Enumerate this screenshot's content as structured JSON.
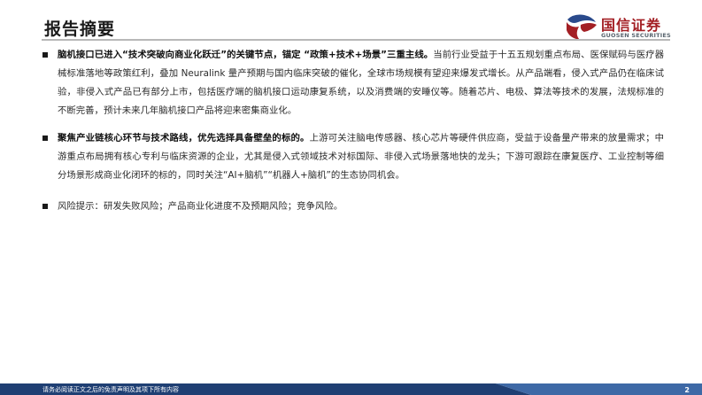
{
  "header": {
    "title": "报告摘要",
    "logo_cn": "国信证券",
    "logo_en": "GUOSEN SECURITIES",
    "logo_colors": {
      "red": "#a31f24",
      "blue": "#2a4a8c"
    }
  },
  "bullets": [
    {
      "strong": "脑机接口已进入“技术突破向商业化跃迁”的关键节点，锚定 “政策+技术+场景”三重主线。",
      "text": "当前行业受益于十五五规划重点布局、医保赋码与医疗器械标准落地等政策红利，叠加 Neuralink 量产预期与国内临床突破的催化，全球市场规模有望迎来爆发式增长。从产品端看，侵入式产品仍在临床试验，非侵入式产品已有部分上市，包括医疗端的脑机接口运动康复系统，以及消费端的安睡仪等。随着芯片、电极、算法等技术的发展，法规标准的不断完善，预计未来几年脑机接口产品将迎来密集商业化。"
    },
    {
      "strong": "聚焦产业链核心环节与技术路线，优先选择具备壁垒的标的。",
      "text": "上游可关注脑电传感器、核心芯片等硬件供应商，受益于设备量产带来的放量需求；中游重点布局拥有核心专利与临床资源的企业，尤其是侵入式领域技术对标国际、非侵入式场景落地快的龙头；下游可跟踪在康复医疗、工业控制等细分场景形成商业化闭环的标的，同时关注“AI+脑机”“机器人+脑机”的生态协同机会。"
    },
    {
      "strong": "",
      "text": "风险提示：研发失败风险；产品商业化进度不及预期风险；竞争风险。"
    }
  ],
  "footer": {
    "disclaimer": "请务必阅读正文之后的免责声明及其项下所有内容",
    "page_number": "2",
    "band_dark": "#1f3f73",
    "band_light": "#3e69a6"
  }
}
